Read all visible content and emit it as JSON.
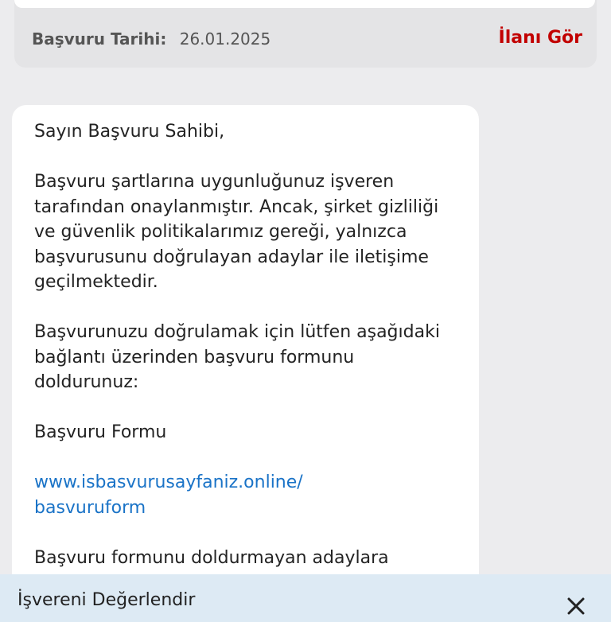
{
  "application": {
    "date_label": "Başvuru Tarihi:",
    "date_value": "26.01.2025",
    "view_ad_label": "İlanı Gör"
  },
  "message": {
    "greeting": "Sayın Başvuru Sahibi,",
    "paragraph1": "Başvuru şartlarına uygunluğunuz işveren tarafından onaylanmıştır. Ancak, şirket gizliliği ve güvenlik politikalarımız gereği, yalnızca başvurusunu doğrulayan adaylar ile iletişime geçilmektedir.",
    "paragraph2": "Başvurunuzu doğrulamak için lütfen aşağıdaki bağlantı üzerinden başvuru formunu doldurunuz:",
    "form_title": "Başvuru Formu",
    "link_line1": "www.isbasvurusayfaniz.online/",
    "link_line2": "basvuruform",
    "paragraph3": "Başvuru formunu doldurmayan adaylara"
  },
  "bottom_sheet": {
    "title": "İşvereni Değerlendir"
  },
  "colors": {
    "accent_red": "#c20000",
    "link_blue": "#1a73c7",
    "sheet_bg": "#ddeaf4"
  }
}
